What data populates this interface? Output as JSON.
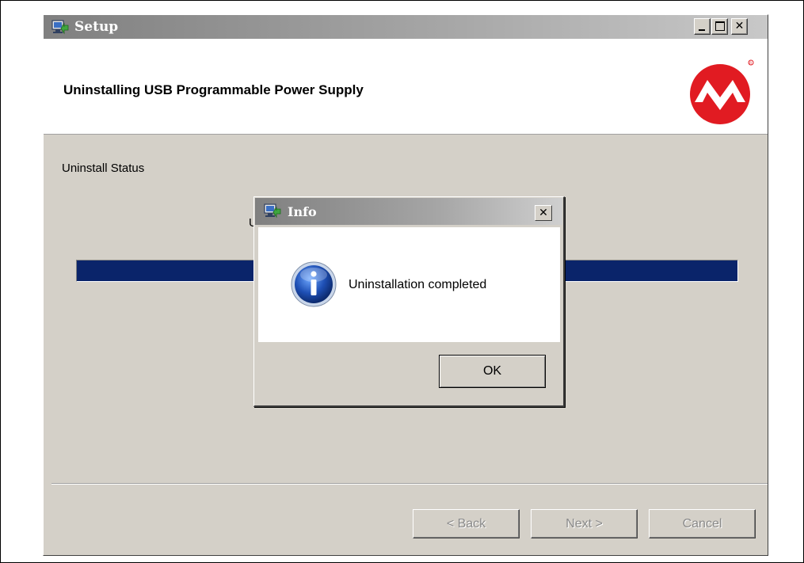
{
  "setup_window": {
    "title": "Setup",
    "controls": {
      "minimize": "minimize",
      "maximize": "maximize",
      "close": "✕"
    },
    "header_title": "Uninstalling USB Programmable Power Supply",
    "status_label": "Uninstall Status",
    "progress_fraction": 1.0,
    "partial_status_char": "U",
    "buttons": {
      "back": "< Back",
      "next": "Next >",
      "cancel": "Cancel"
    }
  },
  "info_dialog": {
    "title": "Info",
    "close": "✕",
    "message": "Uninstallation completed",
    "ok": "OK"
  },
  "colors": {
    "progress_fill": "#0a246a",
    "logo_red": "#e11b22",
    "info_blue": "#1e4fb4"
  },
  "icons": {
    "app": "setup-app-icon",
    "logo": "microchip-logo",
    "info": "info-icon"
  }
}
